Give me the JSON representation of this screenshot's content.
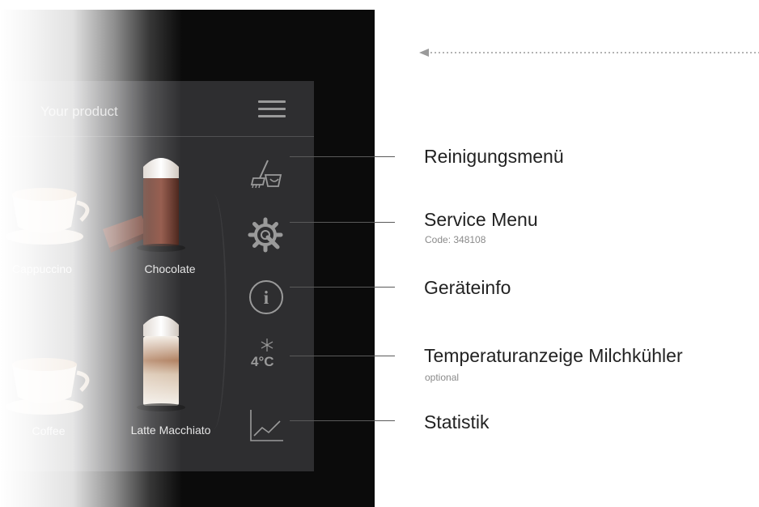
{
  "screen": {
    "header_title": "Your product",
    "menu_icon": "hamburger-menu-icon",
    "products": [
      {
        "label": "Cappuccino",
        "icon": "cappuccino-cup-icon"
      },
      {
        "label": "Chocolate",
        "icon": "chocolate-glass-icon"
      },
      {
        "label": "Coffee",
        "icon": "coffee-cup-icon"
      },
      {
        "label": "Latte Macchiato",
        "icon": "latte-macchiato-glass-icon"
      }
    ],
    "sidebar": {
      "cleaning_icon": "broom-bucket-icon",
      "service_icon": "gear-wrench-icon",
      "info_icon": "info-circle-icon",
      "info_glyph": "i",
      "temperature_icon": "snowflake-icon",
      "temperature_value": "4°C",
      "statistics_icon": "line-chart-icon"
    }
  },
  "callouts": [
    {
      "label": "Reinigungsmenü",
      "sub": ""
    },
    {
      "label": "Service Menu",
      "sub": "Code: 348108"
    },
    {
      "label": "Geräteinfo",
      "sub": ""
    },
    {
      "label": "Temperaturanzeige Milchkühler",
      "sub": "optional"
    },
    {
      "label": "Statistik",
      "sub": ""
    }
  ],
  "colors": {
    "device_bg": "#0b0b0b",
    "panel_bg": "#2e2e30",
    "icon_gray": "#9a9a9a",
    "callout_text": "#222222"
  }
}
